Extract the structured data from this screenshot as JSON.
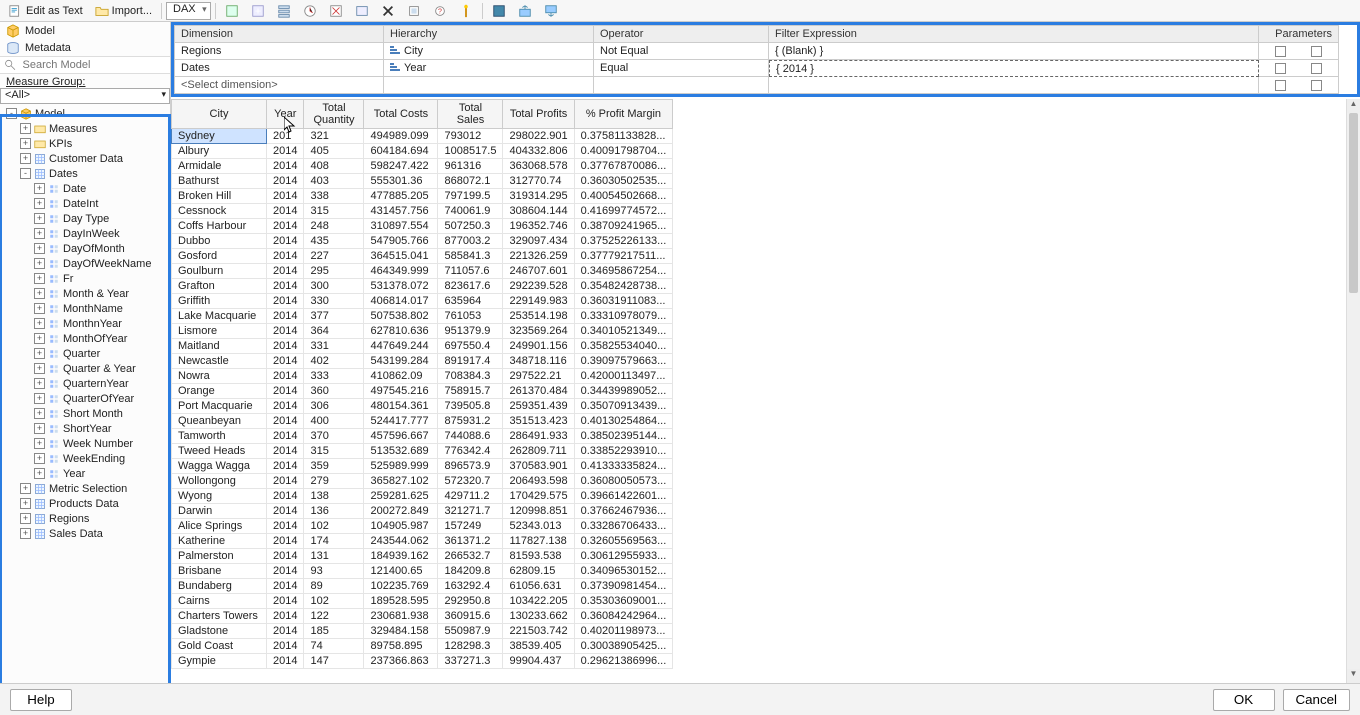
{
  "toolbar": {
    "edit_as_text": "Edit as Text",
    "import": "Import...",
    "dax_label": "DAX"
  },
  "sidebar": {
    "model": "Model",
    "metadata": "Metadata",
    "search_placeholder": "Search Model",
    "measure_group_label": "Measure Group:",
    "measure_group_value": "<All>",
    "tree": [
      {
        "lvl": 0,
        "tw": "-",
        "icon": "cube",
        "label": "Model"
      },
      {
        "lvl": 1,
        "tw": "+",
        "icon": "folder",
        "label": "Measures"
      },
      {
        "lvl": 1,
        "tw": "+",
        "icon": "folder",
        "label": "KPIs"
      },
      {
        "lvl": 1,
        "tw": "+",
        "icon": "dim",
        "label": "Customer Data"
      },
      {
        "lvl": 1,
        "tw": "-",
        "icon": "dim",
        "label": "Dates"
      },
      {
        "lvl": 2,
        "tw": "+",
        "icon": "attr",
        "label": "Date"
      },
      {
        "lvl": 2,
        "tw": "+",
        "icon": "attr",
        "label": "DateInt"
      },
      {
        "lvl": 2,
        "tw": "+",
        "icon": "attr",
        "label": "Day Type"
      },
      {
        "lvl": 2,
        "tw": "+",
        "icon": "attr",
        "label": "DayInWeek"
      },
      {
        "lvl": 2,
        "tw": "+",
        "icon": "attr",
        "label": "DayOfMonth"
      },
      {
        "lvl": 2,
        "tw": "+",
        "icon": "attr",
        "label": "DayOfWeekName"
      },
      {
        "lvl": 2,
        "tw": "+",
        "icon": "attr",
        "label": "Fr"
      },
      {
        "lvl": 2,
        "tw": "+",
        "icon": "attr",
        "label": "Month & Year"
      },
      {
        "lvl": 2,
        "tw": "+",
        "icon": "attr",
        "label": "MonthName"
      },
      {
        "lvl": 2,
        "tw": "+",
        "icon": "attr",
        "label": "MonthnYear"
      },
      {
        "lvl": 2,
        "tw": "+",
        "icon": "attr",
        "label": "MonthOfYear"
      },
      {
        "lvl": 2,
        "tw": "+",
        "icon": "attr",
        "label": "Quarter"
      },
      {
        "lvl": 2,
        "tw": "+",
        "icon": "attr",
        "label": "Quarter & Year"
      },
      {
        "lvl": 2,
        "tw": "+",
        "icon": "attr",
        "label": "QuarternYear"
      },
      {
        "lvl": 2,
        "tw": "+",
        "icon": "attr",
        "label": "QuarterOfYear"
      },
      {
        "lvl": 2,
        "tw": "+",
        "icon": "attr",
        "label": "Short Month"
      },
      {
        "lvl": 2,
        "tw": "+",
        "icon": "attr",
        "label": "ShortYear"
      },
      {
        "lvl": 2,
        "tw": "+",
        "icon": "attr",
        "label": "Week Number"
      },
      {
        "lvl": 2,
        "tw": "+",
        "icon": "attr",
        "label": "WeekEnding"
      },
      {
        "lvl": 2,
        "tw": "+",
        "icon": "attr",
        "label": "Year"
      },
      {
        "lvl": 1,
        "tw": "+",
        "icon": "dim",
        "label": "Metric Selection"
      },
      {
        "lvl": 1,
        "tw": "+",
        "icon": "dim",
        "label": "Products Data"
      },
      {
        "lvl": 1,
        "tw": "+",
        "icon": "dim",
        "label": "Regions"
      },
      {
        "lvl": 1,
        "tw": "+",
        "icon": "dim",
        "label": "Sales Data"
      }
    ]
  },
  "filters": {
    "headers": {
      "dimension": "Dimension",
      "hierarchy": "Hierarchy",
      "operator": "Operator",
      "expression": "Filter Expression",
      "parameters": "Parameters"
    },
    "rows": [
      {
        "dimension": "Regions",
        "hierarchy": "City",
        "operator": "Not Equal",
        "expression": "{ (Blank) }"
      },
      {
        "dimension": "Dates",
        "hierarchy": "Year",
        "operator": "Equal",
        "expression": "{ 2014 }"
      }
    ],
    "select_dim": "<Select dimension>"
  },
  "grid": {
    "headers": [
      "City",
      "Year",
      "Total Quantity",
      "Total Costs",
      "Total Sales",
      "Total Profits",
      "% Profit Margin"
    ],
    "rows": [
      [
        "Sydney",
        "201",
        "321",
        "494989.099",
        "793012",
        "298022.901",
        "0.37581133828..."
      ],
      [
        "Albury",
        "2014",
        "405",
        "604184.694",
        "1008517.5",
        "404332.806",
        "0.40091798704..."
      ],
      [
        "Armidale",
        "2014",
        "408",
        "598247.422",
        "961316",
        "363068.578",
        "0.37767870086..."
      ],
      [
        "Bathurst",
        "2014",
        "403",
        "555301.36",
        "868072.1",
        "312770.74",
        "0.36030502535..."
      ],
      [
        "Broken Hill",
        "2014",
        "338",
        "477885.205",
        "797199.5",
        "319314.295",
        "0.40054502668..."
      ],
      [
        "Cessnock",
        "2014",
        "315",
        "431457.756",
        "740061.9",
        "308604.144",
        "0.41699774572..."
      ],
      [
        "Coffs Harbour",
        "2014",
        "248",
        "310897.554",
        "507250.3",
        "196352.746",
        "0.38709241965..."
      ],
      [
        "Dubbo",
        "2014",
        "435",
        "547905.766",
        "877003.2",
        "329097.434",
        "0.37525226133..."
      ],
      [
        "Gosford",
        "2014",
        "227",
        "364515.041",
        "585841.3",
        "221326.259",
        "0.37779217511..."
      ],
      [
        "Goulburn",
        "2014",
        "295",
        "464349.999",
        "711057.6",
        "246707.601",
        "0.34695867254..."
      ],
      [
        "Grafton",
        "2014",
        "300",
        "531378.072",
        "823617.6",
        "292239.528",
        "0.35482428738..."
      ],
      [
        "Griffith",
        "2014",
        "330",
        "406814.017",
        "635964",
        "229149.983",
        "0.36031911083..."
      ],
      [
        "Lake Macquarie",
        "2014",
        "377",
        "507538.802",
        "761053",
        "253514.198",
        "0.33310978079..."
      ],
      [
        "Lismore",
        "2014",
        "364",
        "627810.636",
        "951379.9",
        "323569.264",
        "0.34010521349..."
      ],
      [
        "Maitland",
        "2014",
        "331",
        "447649.244",
        "697550.4",
        "249901.156",
        "0.35825534040..."
      ],
      [
        "Newcastle",
        "2014",
        "402",
        "543199.284",
        "891917.4",
        "348718.116",
        "0.39097579663..."
      ],
      [
        "Nowra",
        "2014",
        "333",
        "410862.09",
        "708384.3",
        "297522.21",
        "0.42000113497..."
      ],
      [
        "Orange",
        "2014",
        "360",
        "497545.216",
        "758915.7",
        "261370.484",
        "0.34439989052..."
      ],
      [
        "Port Macquarie",
        "2014",
        "306",
        "480154.361",
        "739505.8",
        "259351.439",
        "0.35070913439..."
      ],
      [
        "Queanbeyan",
        "2014",
        "400",
        "524417.777",
        "875931.2",
        "351513.423",
        "0.40130254864..."
      ],
      [
        "Tamworth",
        "2014",
        "370",
        "457596.667",
        "744088.6",
        "286491.933",
        "0.38502395144..."
      ],
      [
        "Tweed Heads",
        "2014",
        "315",
        "513532.689",
        "776342.4",
        "262809.711",
        "0.33852293910..."
      ],
      [
        "Wagga Wagga",
        "2014",
        "359",
        "525989.999",
        "896573.9",
        "370583.901",
        "0.41333335824..."
      ],
      [
        "Wollongong",
        "2014",
        "279",
        "365827.102",
        "572320.7",
        "206493.598",
        "0.36080050573..."
      ],
      [
        "Wyong",
        "2014",
        "138",
        "259281.625",
        "429711.2",
        "170429.575",
        "0.39661422601..."
      ],
      [
        "Darwin",
        "2014",
        "136",
        "200272.849",
        "321271.7",
        "120998.851",
        "0.37662467936..."
      ],
      [
        "Alice Springs",
        "2014",
        "102",
        "104905.987",
        "157249",
        "52343.013",
        "0.33286706433..."
      ],
      [
        "Katherine",
        "2014",
        "174",
        "243544.062",
        "361371.2",
        "117827.138",
        "0.32605569563..."
      ],
      [
        "Palmerston",
        "2014",
        "131",
        "184939.162",
        "266532.7",
        "81593.538",
        "0.30612955933..."
      ],
      [
        "Brisbane",
        "2014",
        "93",
        "121400.65",
        "184209.8",
        "62809.15",
        "0.34096530152..."
      ],
      [
        "Bundaberg",
        "2014",
        "89",
        "102235.769",
        "163292.4",
        "61056.631",
        "0.37390981454..."
      ],
      [
        "Cairns",
        "2014",
        "102",
        "189528.595",
        "292950.8",
        "103422.205",
        "0.35303609001..."
      ],
      [
        "Charters Towers",
        "2014",
        "122",
        "230681.938",
        "360915.6",
        "130233.662",
        "0.36084242964..."
      ],
      [
        "Gladstone",
        "2014",
        "185",
        "329484.158",
        "550987.9",
        "221503.742",
        "0.40201198973..."
      ],
      [
        "Gold Coast",
        "2014",
        "74",
        "89758.895",
        "128298.3",
        "38539.405",
        "0.30038905425..."
      ],
      [
        "Gympie",
        "2014",
        "147",
        "237366.863",
        "337271.3",
        "99904.437",
        "0.29621386996..."
      ]
    ]
  },
  "footer": {
    "help": "Help",
    "ok": "OK",
    "cancel": "Cancel"
  }
}
